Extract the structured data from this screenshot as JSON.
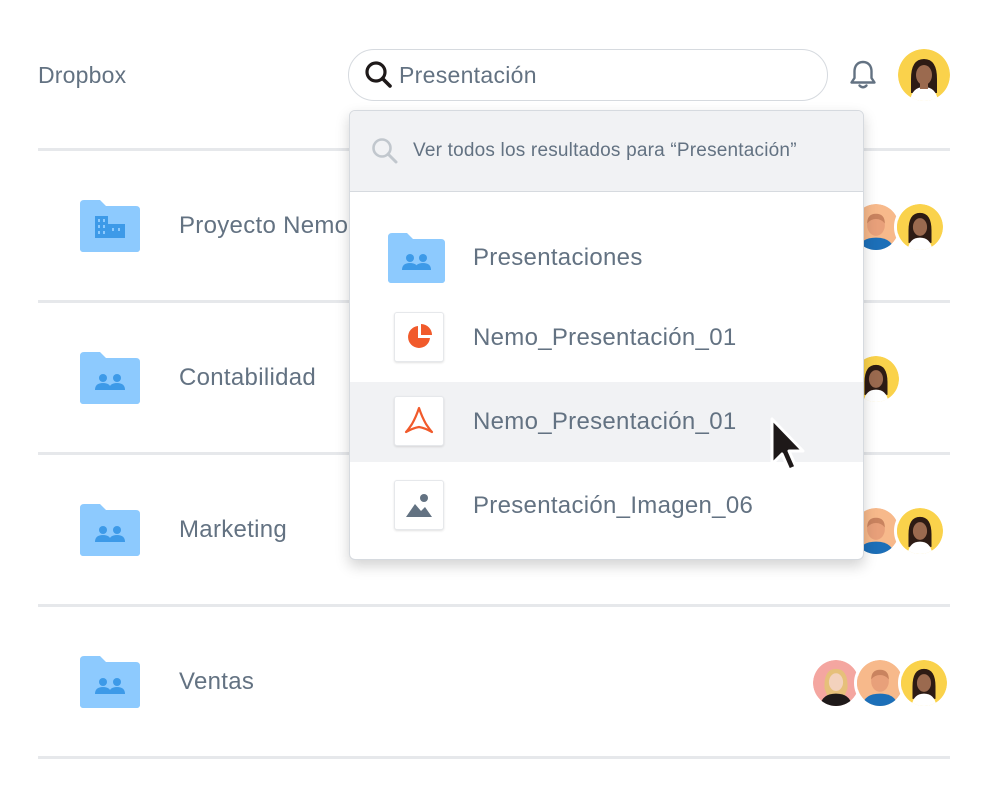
{
  "header": {
    "app_title": "Dropbox",
    "search_value": "Presentación"
  },
  "dropdown": {
    "all_results_label": "Ver todos los resultados para “Presentación”",
    "items": [
      {
        "label": "Presentaciones",
        "icon": "shared-folder-icon",
        "active": false
      },
      {
        "label": "Nemo_Presentación_01",
        "icon": "pie-chart-file-icon",
        "active": false
      },
      {
        "label": "Nemo_Presentación_01",
        "icon": "pdf-file-icon",
        "active": true
      },
      {
        "label": "Presentación_Imagen_06",
        "icon": "image-file-icon",
        "active": false
      }
    ]
  },
  "folders": [
    {
      "name": "Proyecto Nemo",
      "icon": "building-folder-icon"
    },
    {
      "name": "Contabilidad",
      "icon": "shared-folder-icon"
    },
    {
      "name": "Marketing",
      "icon": "shared-folder-icon"
    },
    {
      "name": "Ventas",
      "icon": "shared-folder-icon"
    }
  ],
  "colors": {
    "folder_blue": "#8dcafe",
    "folder_accent": "#3d9ae8",
    "file_icon_red": "#f15a2b",
    "text": "#637282",
    "divider": "#e6e8eb",
    "hover_bg": "#f1f2f4"
  }
}
